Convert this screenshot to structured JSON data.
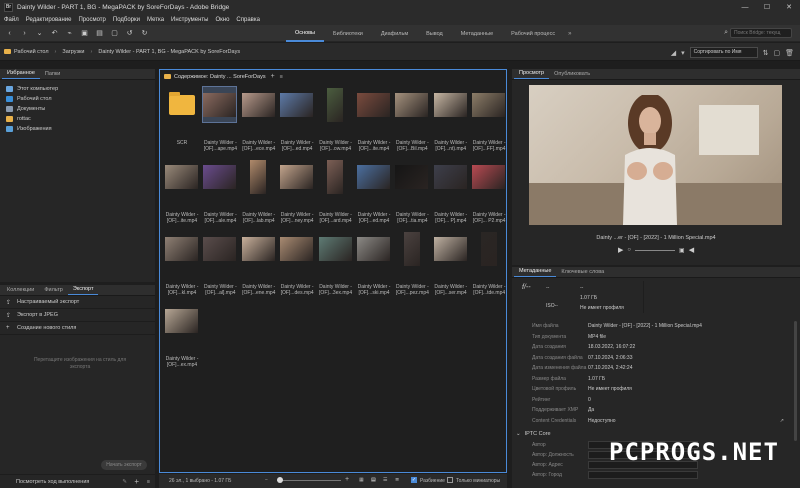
{
  "window": {
    "title": "Dainty Wilder - PART 1, BG - MegaPACK by SoreForDays - Adobe Bridge",
    "app_icon": "Br"
  },
  "menu": [
    "Файл",
    "Редактирование",
    "Просмотр",
    "Подборки",
    "Метка",
    "Инструменты",
    "Окно",
    "Справка"
  ],
  "workspaces": {
    "tabs": [
      "Основы",
      "Библиотеки",
      "Диафильм",
      "Вывод",
      "Метаданные",
      "Рабочий процесс"
    ],
    "active": 0
  },
  "search": {
    "placeholder": "Поиск Bridge: текущ"
  },
  "breadcrumb": [
    "Рабочий стол",
    "Загрузки",
    "Dainty Wilder - PART 1, BG - MegaPACK by SoreForDays"
  ],
  "sort_label": "Сортировать по Имя",
  "left_panel": {
    "tabs": [
      "Избранное",
      "Папки"
    ],
    "favorites": [
      {
        "label": "Этот компьютер",
        "color": "#6aa7e0"
      },
      {
        "label": "Рабочий стол",
        "color": "#3a8fd9"
      },
      {
        "label": "Документы",
        "color": "#8a9bb0"
      },
      {
        "label": "rottac",
        "color": "#e8b14a"
      },
      {
        "label": "Изображения",
        "color": "#5aa0d8"
      }
    ]
  },
  "bottom_left": {
    "tabs": [
      "Коллекции",
      "Фильтр",
      "Экспорт"
    ],
    "rows": [
      "Настраиваемый экспорт",
      "Экспорт в JPEG",
      "Создание нового стиля"
    ],
    "drop_hint": "Перетащите изображения на стиль для экспорта",
    "export_button": "Начать экспорт",
    "progress_label": "Посмотреть ход выполнения"
  },
  "content": {
    "header": "Содержимое: Dainty ... SoreForDays",
    "items": [
      {
        "label": "SCR",
        "type": "folder"
      },
      {
        "label": "Dainty Wilder - [OF]...ape.mp4",
        "color": "#8a6a5f",
        "selected": true
      },
      {
        "label": "Dainty Wilder - [OF]...ece.mp4",
        "color": "#b79a8b"
      },
      {
        "label": "Dainty Wilder - [OF]...ed.mp4",
        "color": "#5d7aa8"
      },
      {
        "label": "Dainty Wilder - [OF]...ow.mp4",
        "color": "#4b5d3f",
        "portrait": true
      },
      {
        "label": "Dainty Wilder - [OF]...ite.mp4",
        "color": "#7a4b3e"
      },
      {
        "label": "Dainty Wilder - [OF]...Bil.mp4",
        "color": "#a5927e"
      },
      {
        "label": "Dainty Wilder - [OF]...nt).mp4",
        "color": "#c6b6a3"
      },
      {
        "label": "Dainty Wilder - [OF]...FF].mp4",
        "color": "#8c7d68"
      },
      {
        "label": "Dainty Wilder - [OF]...ite.mp4",
        "color": "#9a8a7a"
      },
      {
        "label": "Dainty Wilder - [OF]...ale.mp4",
        "color": "#6a4c8e"
      },
      {
        "label": "Dainty Wilder - [OF]...lab.mp4",
        "color": "#b08a6b",
        "portrait": true
      },
      {
        "label": "Dainty Wilder - [OF]...ney.mp4",
        "color": "#c2a48c"
      },
      {
        "label": "Dainty Wilder - [OF]...ard.mp4",
        "color": "#7c5f55",
        "portrait": true
      },
      {
        "label": "Dainty Wilder - [OF]...ed.mp4",
        "color": "#4b6fa0"
      },
      {
        "label": "Dainty Wilder - [OF]...tia.mp4",
        "color": "#151515"
      },
      {
        "label": "Dainty Wilder - [OF]... P].mp4",
        "color": "#3d3f4b"
      },
      {
        "label": "Dainty Wilder - [OF]... P2.mp4",
        "color": "#b84a52"
      },
      {
        "label": "Dainty Wilder - [OF]...kl.mp4",
        "color": "#8f8074"
      },
      {
        "label": "Dainty Wilder - [OF]...al].mp4",
        "color": "#5a4d4c"
      },
      {
        "label": "Dainty Wilder - [OF]...ene.mp4",
        "color": "#c8b09b"
      },
      {
        "label": "Dainty Wilder - [OF]...des.mp4",
        "color": "#a98b72"
      },
      {
        "label": "Dainty Wilder - [OF]...3ex.mp4",
        "color": "#5e7b74"
      },
      {
        "label": "Dainty Wilder - [OF]...ski.mp4",
        "color": "#8c8a86"
      },
      {
        "label": "Dainty Wilder - [OF]...pez.mp4",
        "color": "#4b4240",
        "portrait": true
      },
      {
        "label": "Dainty Wilder - [OF]...ser.mp4",
        "color": "#bfb1a2"
      },
      {
        "label": "Dainty Wilder - [OF]...tde.mp4",
        "color": "#2a2624",
        "portrait": true
      },
      {
        "label": "Dainty Wilder - [OF]...ex.mp4",
        "color": "#b7a795"
      }
    ]
  },
  "status": {
    "text": "26 эл., 1 выбрано - 1.07 ГБ",
    "razbienie": "Разбиение",
    "only_thumbs": "Только миниатюры"
  },
  "preview": {
    "tabs": [
      "Просмотр",
      "Опубликовать"
    ],
    "caption": "Dainty ...er - [OF] - [2022] - 1 Million Special.mp4"
  },
  "metadata": {
    "tabs": [
      "Метаданные",
      "Ключевые слова"
    ],
    "head": {
      "fstop": "f/--",
      "dash1": "--",
      "iso": "ISO--",
      "size": "1.07 ГБ",
      "profile": "Не имеет профиля",
      "dash2": "--"
    },
    "rows": [
      {
        "k": "Имя файла",
        "v": "Dainty Wilder - [OF] - [2022] - 1 Million Special.mp4"
      },
      {
        "k": "Тип документа",
        "v": "MP4 file"
      },
      {
        "k": "Дата создания",
        "v": "18.03.2022, 16:07:22"
      },
      {
        "k": "Дата создания файла",
        "v": "07.10.2024, 2:06:33"
      },
      {
        "k": "Дата изменения файла",
        "v": "07.10.2024, 2:42:24"
      },
      {
        "k": "Размер файла",
        "v": "1.07 ГБ"
      },
      {
        "k": "Цветовой профиль",
        "v": "Не имеет профиля"
      },
      {
        "k": "Рейтинг",
        "v": "0"
      },
      {
        "k": "Поддерживает XMP",
        "v": "Да"
      },
      {
        "k": "Content Credentials",
        "v": "Недоступно"
      }
    ],
    "iptc_title": "IPTC Core",
    "iptc_fields": [
      "Автор",
      "Автор: Должность",
      "Автор: Адрес",
      "Автор: Город"
    ]
  },
  "watermark": "PCPROGS.NET"
}
